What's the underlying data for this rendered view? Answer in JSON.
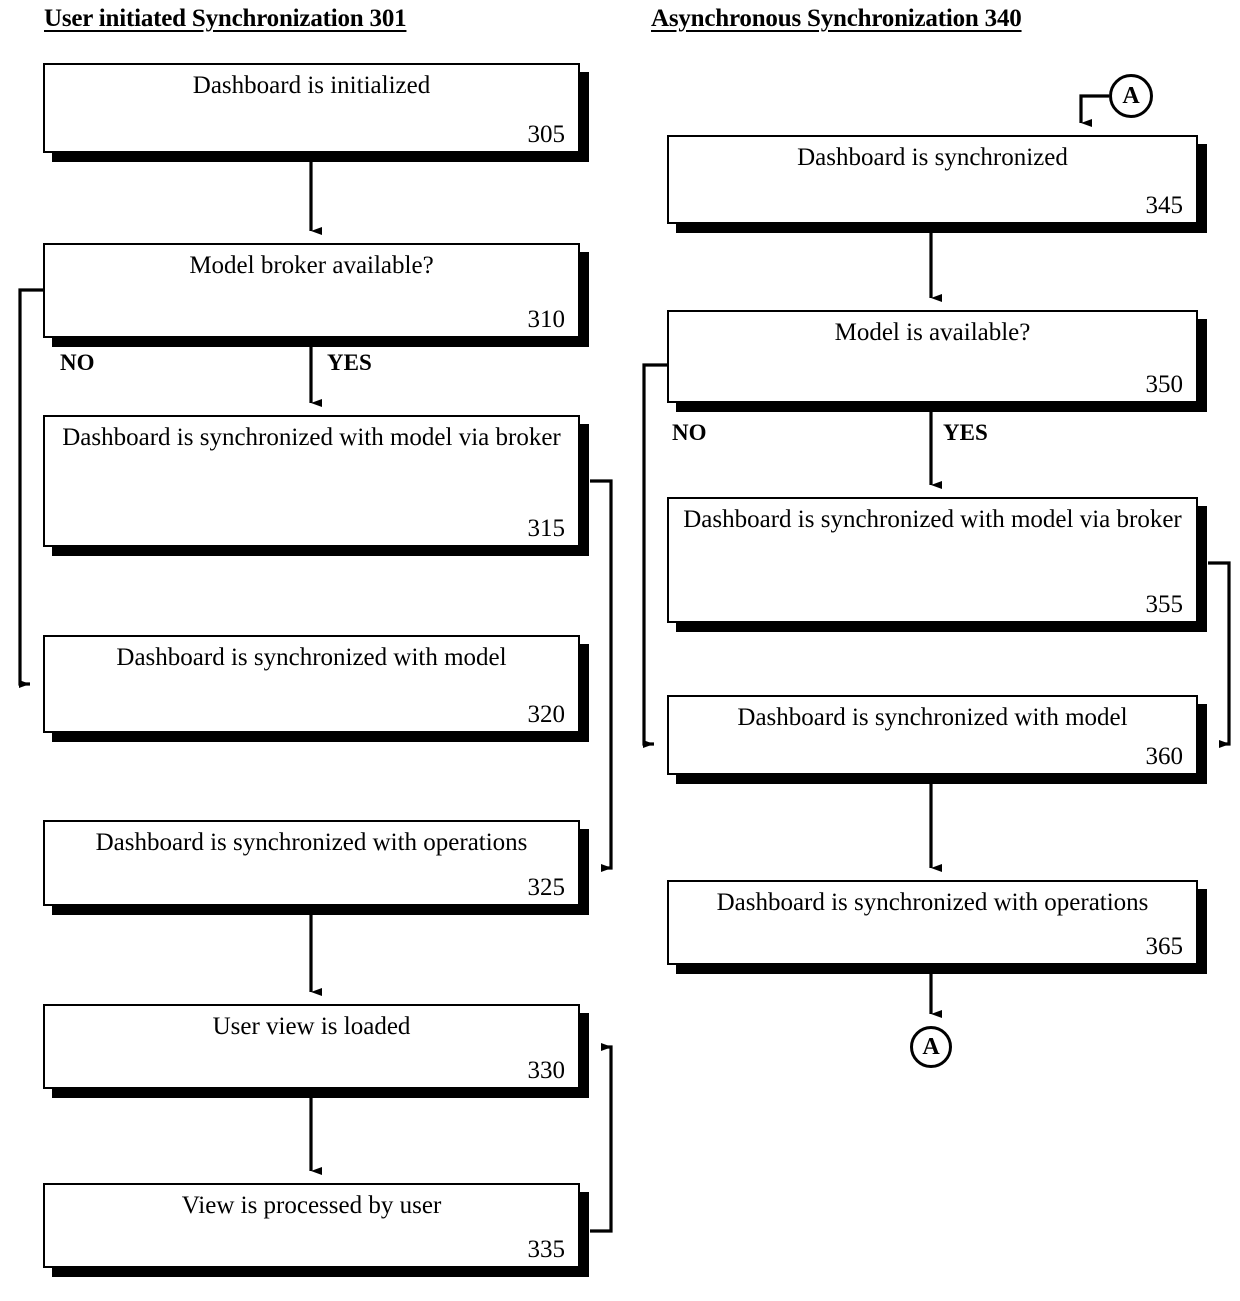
{
  "figure": {
    "columns": [
      {
        "id": "left-column",
        "title": "User initiated Synchronization 301"
      },
      {
        "id": "right-column",
        "title": "Asynchronous Synchronization 340"
      }
    ],
    "left_column_steps": [
      {
        "text": "Dashboard is initialized",
        "number": "305"
      },
      {
        "text": "Model broker available?",
        "number": "310"
      },
      {
        "text": "Dashboard is synchronized with model via broker",
        "number": "315"
      },
      {
        "text": "Dashboard is synchronized with model",
        "number": "320"
      },
      {
        "text": "Dashboard is synchronized with operations",
        "number": "325"
      },
      {
        "text": "User view is loaded",
        "number": "330"
      },
      {
        "text": "View is processed by user",
        "number": "335"
      }
    ],
    "right_column_steps": [
      {
        "text": "Dashboard is synchronized",
        "number": "345"
      },
      {
        "text": "Model is available?",
        "number": "350"
      },
      {
        "text": "Dashboard is synchronized with model via broker",
        "number": "355"
      },
      {
        "text": "Dashboard is synchronized with model",
        "number": "360"
      },
      {
        "text": "Dashboard is synchronized with operations",
        "number": "365"
      }
    ],
    "branch_labels": {
      "left_no": "NO",
      "left_yes": "YES",
      "right_no": "NO",
      "right_yes": "YES"
    },
    "connectors": {
      "entry_label": "A",
      "exit_label": "A"
    },
    "colors": {
      "stroke": "#000000",
      "fill": "#ffffff",
      "shadow": "#000000"
    }
  }
}
